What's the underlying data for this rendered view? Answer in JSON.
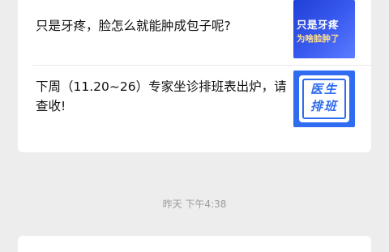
{
  "articles": [
    {
      "title": "只是牙疼，脸怎么就能肿成包子呢?",
      "thumb_line_1": "只是牙疼",
      "thumb_line_2": "为啥脸肿了"
    },
    {
      "title": "下周（11.20~26）专家坐诊排班表出炉，请查收!",
      "thumb_line_1": "医生",
      "thumb_line_2": "排班"
    }
  ],
  "timestamp": "昨天 下午4:38",
  "colors": {
    "background": "#ededed",
    "card": "#ffffff",
    "title_text": "#111111",
    "timestamp_text": "#9b9b9b",
    "thumb_blue": "#2f6cf0"
  }
}
